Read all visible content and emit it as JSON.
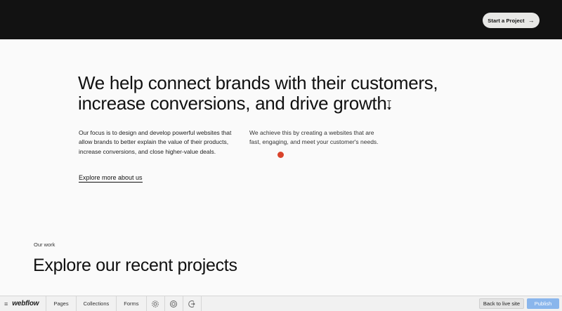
{
  "header": {
    "cta_label": "Start a Project",
    "cta_icon": "arrow-right-icon"
  },
  "hero": {
    "headline_line1": "We help connect brands with their customers,",
    "headline_line2": "increase conversions, and drive growth.",
    "paragraph_left": "Our focus is to design and develop powerful websites that allow brands to better explain the value of their products, increase conversions, and close higher-value deals.",
    "paragraph_right": "We achieve this by creating a websites that are fast, engaging, and meet your customer's needs.",
    "link_label": "Explore more about us"
  },
  "work": {
    "label": "Our work",
    "title": "Explore our recent projects"
  },
  "webflow_bar": {
    "menu_icon": "menu-icon",
    "logo": "webflow",
    "tabs": [
      "Pages",
      "Collections",
      "Forms"
    ],
    "icons": [
      "gear-icon",
      "target-icon",
      "audit-icon"
    ],
    "back_label": "Back to live site",
    "publish_label": "Publish"
  },
  "colors": {
    "topbar": "#121212",
    "cursor_dot": "#d9432b",
    "publish": "#8ab6ec",
    "background": "#fafafa"
  }
}
